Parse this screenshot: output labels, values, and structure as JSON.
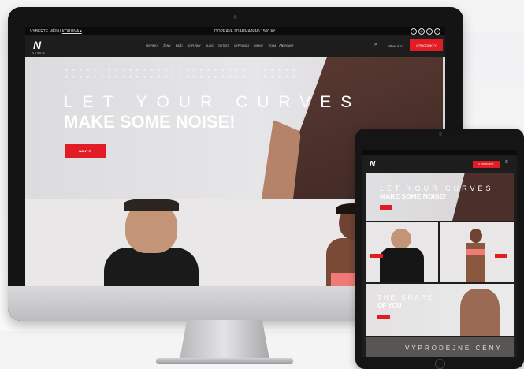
{
  "site": {
    "topbar_left": "VYBERTE MĚNU",
    "topbar_currency": "KORUNA ▾",
    "topbar_center": "DOPRAVA ZDARMA NAD 1500 Kč",
    "social_icons": [
      "facebook-icon",
      "instagram-icon",
      "youtube-icon",
      "twitter-icon"
    ],
    "logo": "N",
    "logo_sub": "NEBBIA",
    "nav": [
      "NOVINKY",
      "ŽENY",
      "MUŽI",
      "DOPLŇKY",
      "BLOG",
      "OUTLET",
      "VÝPRODEJ",
      "BIKINY",
      "TEAM",
      "KONTAKT"
    ],
    "login": "PŘIHLÁSIT",
    "cart": "0 PRODUKTY"
  },
  "hero": {
    "line1": "LET YOUR CURVES",
    "line2": "MAKE SOME NOISE!",
    "button": "WANT IT"
  },
  "ipad": {
    "hero_line1": "LET YOUR CURVES",
    "hero_line2": "MAKE SOME NOISE!",
    "section_line1": "THE SHAPE",
    "section_line2": "OF YOU",
    "bottom_text": "VÝPRODEJNE CENY"
  },
  "colors": {
    "accent": "#e11c24",
    "dark": "#1d1d1d"
  }
}
